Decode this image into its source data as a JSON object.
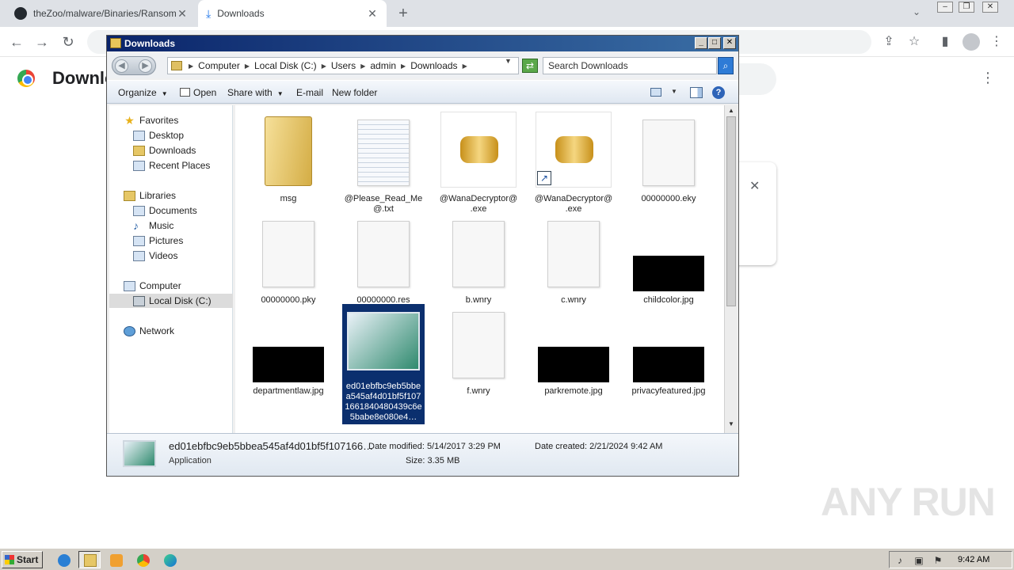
{
  "browser": {
    "tabs": [
      {
        "title": "theZoo/malware/Binaries/Ransomwa",
        "icon": "github-icon"
      },
      {
        "title": "Downloads",
        "icon": "download-icon"
      }
    ],
    "new_tab": "+",
    "page_title": "Downlo",
    "accent": "#1a73e8"
  },
  "explorer": {
    "window_title": "Downloads",
    "breadcrumbs": [
      "Computer",
      "Local Disk (C:)",
      "Users",
      "admin",
      "Downloads"
    ],
    "search_placeholder": "Search Downloads",
    "toolbar": {
      "organize": "Organize",
      "open": "Open",
      "share_with": "Share with",
      "email": "E-mail",
      "new_folder": "New folder"
    },
    "nav": {
      "favorites": "Favorites",
      "desktop": "Desktop",
      "downloads": "Downloads",
      "recent_places": "Recent Places",
      "libraries": "Libraries",
      "documents": "Documents",
      "music": "Music",
      "pictures": "Pictures",
      "videos": "Videos",
      "computer": "Computer",
      "local_disk": "Local Disk (C:)",
      "network": "Network"
    },
    "files": [
      {
        "name": "msg",
        "kind": "folder"
      },
      {
        "name": "@Please_Read_Me@.txt",
        "kind": "text"
      },
      {
        "name": "@WanaDecryptor@.exe",
        "kind": "exe"
      },
      {
        "name": "@WanaDecryptor@.exe",
        "kind": "exe-shortcut"
      },
      {
        "name": "00000000.eky",
        "kind": "file"
      },
      {
        "name": "00000000.pky",
        "kind": "file"
      },
      {
        "name": "00000000.res",
        "kind": "file"
      },
      {
        "name": "b.wnry",
        "kind": "file"
      },
      {
        "name": "c.wnry",
        "kind": "file"
      },
      {
        "name": "childcolor.jpg",
        "kind": "image"
      },
      {
        "name": "departmentlaw.jpg",
        "kind": "image"
      },
      {
        "name": "ed01ebfbc9eb5bbea545af4d01bf5f1071661840480439c6e5babe8e080e4…",
        "kind": "app"
      },
      {
        "name": "f.wnry",
        "kind": "file"
      },
      {
        "name": "parkremote.jpg",
        "kind": "image"
      },
      {
        "name": "privacyfeatured.jpg",
        "kind": "image"
      }
    ],
    "details": {
      "name": "ed01ebfbc9eb5bbea545af4d01bf5f107166…",
      "type": "Application",
      "date_modified": "Date modified: 5/14/2017 3:29 PM",
      "size": "Size: 3.35 MB",
      "date_created": "Date created: 2/21/2024 9:42 AM"
    }
  },
  "taskbar": {
    "start": "Start",
    "clock": "9:42 AM"
  },
  "watermark": "ANY RUN"
}
